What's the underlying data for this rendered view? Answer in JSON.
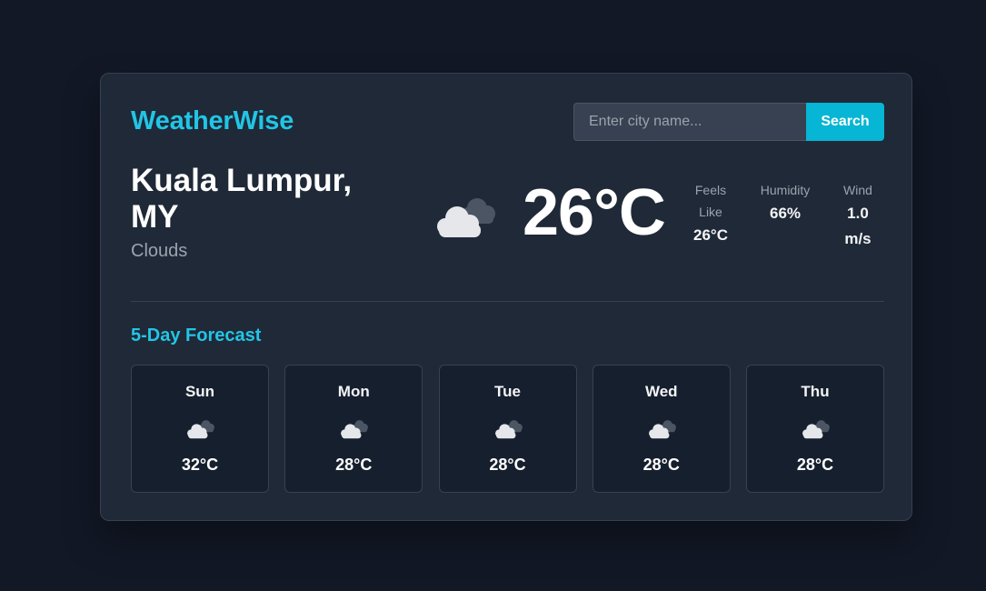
{
  "app": {
    "title": "WeatherWise"
  },
  "search": {
    "placeholder": "Enter city name...",
    "value": "",
    "button_label": "Search"
  },
  "current": {
    "city": "Kuala Lumpur, MY",
    "condition": "Clouds",
    "condition_icon": "clouds-icon",
    "temperature": "26°C",
    "feels_like_label": "Feels Like",
    "feels_like_value": "26°C",
    "humidity_label": "Humidity",
    "humidity_value": "66%",
    "wind_label": "Wind",
    "wind_value": "1.0 m/s"
  },
  "forecast": {
    "title": "5-Day Forecast",
    "days": [
      {
        "day": "Sun",
        "icon": "clouds-icon",
        "temp": "32°C"
      },
      {
        "day": "Mon",
        "icon": "clouds-icon",
        "temp": "28°C"
      },
      {
        "day": "Tue",
        "icon": "clouds-icon",
        "temp": "28°C"
      },
      {
        "day": "Wed",
        "icon": "clouds-icon",
        "temp": "28°C"
      },
      {
        "day": "Thu",
        "icon": "clouds-icon",
        "temp": "28°C"
      }
    ]
  },
  "colors": {
    "page_background": "#121826",
    "card_background": "#1f2937",
    "accent": "#22c5e6",
    "button": "#06b6d4",
    "muted_text": "#9ca3af"
  }
}
